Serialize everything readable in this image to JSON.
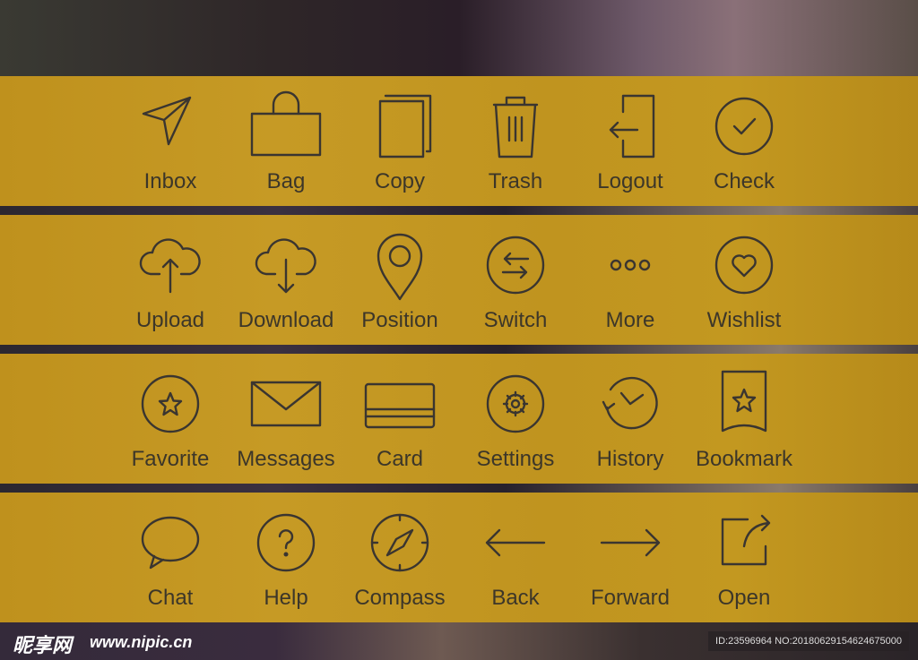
{
  "colors": {
    "band": "#c0921e",
    "icon_stroke": "#3a3530",
    "label": "#3c3629"
  },
  "rows": [
    [
      {
        "label": "Inbox",
        "icon": "paper-plane-icon"
      },
      {
        "label": "Bag",
        "icon": "bag-icon"
      },
      {
        "label": "Copy",
        "icon": "copy-icon"
      },
      {
        "label": "Trash",
        "icon": "trash-icon"
      },
      {
        "label": "Logout",
        "icon": "logout-icon"
      },
      {
        "label": "Check",
        "icon": "check-circle-icon"
      }
    ],
    [
      {
        "label": "Upload",
        "icon": "cloud-upload-icon"
      },
      {
        "label": "Download",
        "icon": "cloud-download-icon"
      },
      {
        "label": "Position",
        "icon": "map-pin-icon"
      },
      {
        "label": "Switch",
        "icon": "switch-arrows-icon"
      },
      {
        "label": "More",
        "icon": "more-dots-icon"
      },
      {
        "label": "Wishlist",
        "icon": "heart-circle-icon"
      }
    ],
    [
      {
        "label": "Favorite",
        "icon": "star-circle-icon"
      },
      {
        "label": "Messages",
        "icon": "envelope-icon"
      },
      {
        "label": "Card",
        "icon": "credit-card-icon"
      },
      {
        "label": "Settings",
        "icon": "gear-circle-icon"
      },
      {
        "label": "History",
        "icon": "history-icon"
      },
      {
        "label": "Bookmark",
        "icon": "bookmark-star-icon"
      }
    ],
    [
      {
        "label": "Chat",
        "icon": "chat-bubble-icon"
      },
      {
        "label": "Help",
        "icon": "help-circle-icon"
      },
      {
        "label": "Compass",
        "icon": "compass-icon"
      },
      {
        "label": "Back",
        "icon": "arrow-left-icon"
      },
      {
        "label": "Forward",
        "icon": "arrow-right-icon"
      },
      {
        "label": "Open",
        "icon": "open-external-icon"
      }
    ]
  ],
  "footer": {
    "logo": "昵享网",
    "site": "www.nipic.cn",
    "id_text": "ID:23596964 NO:20180629154624675000"
  }
}
